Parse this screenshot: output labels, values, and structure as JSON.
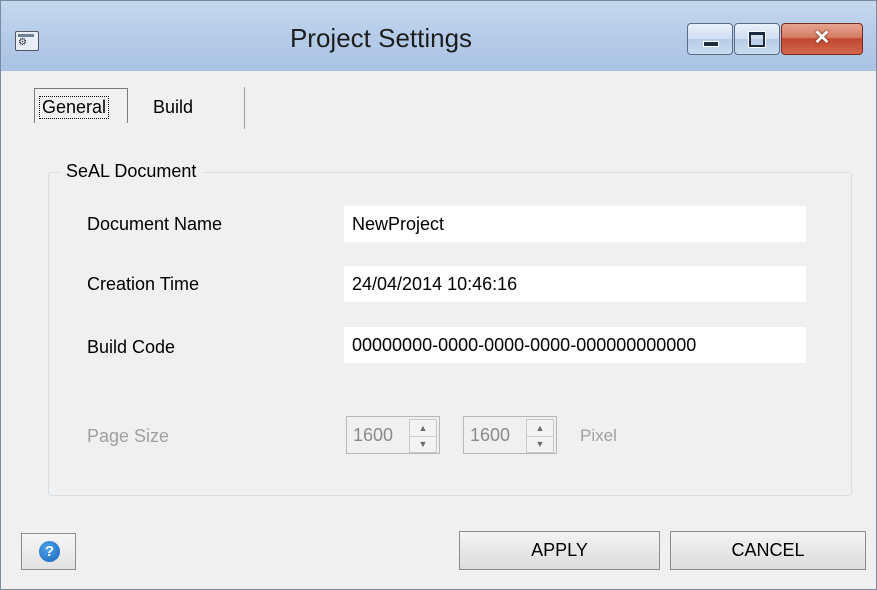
{
  "window": {
    "title": "Project Settings",
    "close_glyph": "✕"
  },
  "tabs": [
    {
      "label": "General",
      "selected": true
    },
    {
      "label": "Build",
      "selected": false
    }
  ],
  "group": {
    "title": "SeAL Document",
    "fields": [
      {
        "label": "Document Name",
        "value": "NewProject"
      },
      {
        "label": "Creation Time",
        "value": "24/04/2014 10:46:16"
      },
      {
        "label": "Build Code",
        "value": "00000000-0000-0000-0000-000000000000"
      }
    ],
    "page_size": {
      "label": "Page Size",
      "width": "1600",
      "height": "1600",
      "unit": "Pixel",
      "enabled": false
    }
  },
  "buttons": {
    "help_glyph": "?",
    "apply": "APPLY",
    "cancel": "CANCEL"
  },
  "icons": {
    "app": "settings-window-icon",
    "help": "help-icon"
  },
  "colors": {
    "titlebar": "#b7cde9",
    "close": "#c9553c",
    "help": "#1e74c8"
  }
}
